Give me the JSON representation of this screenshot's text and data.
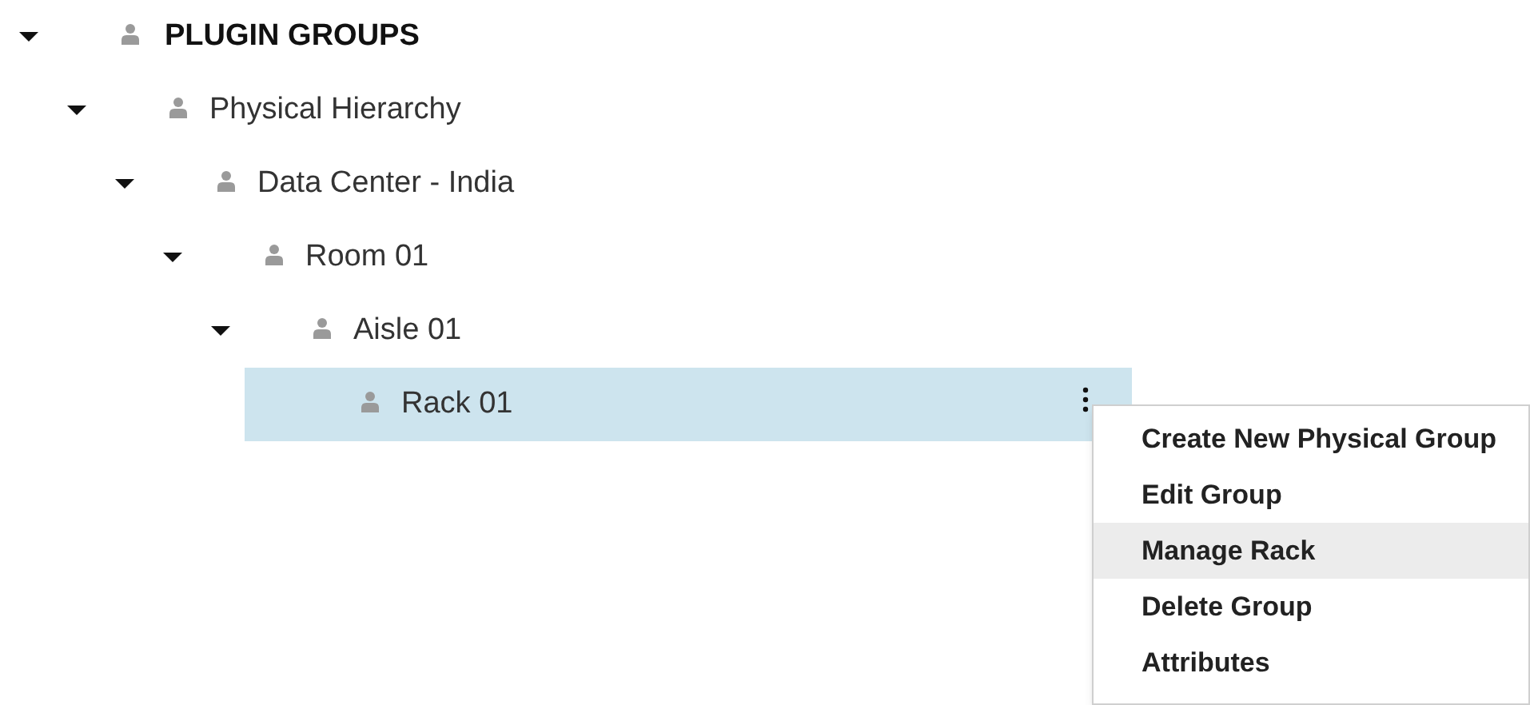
{
  "tree": [
    {
      "label": "PLUGIN GROUPS",
      "kind": "root",
      "expanded": true,
      "selected": false,
      "children": [
        {
          "label": "Physical Hierarchy",
          "kind": "group",
          "expanded": true,
          "selected": false,
          "children": [
            {
              "label": "Data Center - India",
              "kind": "group",
              "expanded": true,
              "selected": false,
              "children": [
                {
                  "label": "Room 01",
                  "kind": "group",
                  "expanded": true,
                  "selected": false,
                  "children": [
                    {
                      "label": "Aisle 01",
                      "kind": "group",
                      "expanded": true,
                      "selected": false,
                      "children": [
                        {
                          "label": "Rack 01",
                          "kind": "group",
                          "selected": true
                        }
                      ]
                    }
                  ]
                }
              ]
            }
          ]
        }
      ]
    }
  ],
  "context_menu": {
    "items": [
      {
        "label": "Create New Physical Group",
        "highlighted": false
      },
      {
        "label": "Edit Group",
        "highlighted": false
      },
      {
        "label": "Manage Rack",
        "highlighted": true
      },
      {
        "label": "Delete Group",
        "highlighted": false
      },
      {
        "label": "Attributes",
        "highlighted": false
      }
    ]
  }
}
